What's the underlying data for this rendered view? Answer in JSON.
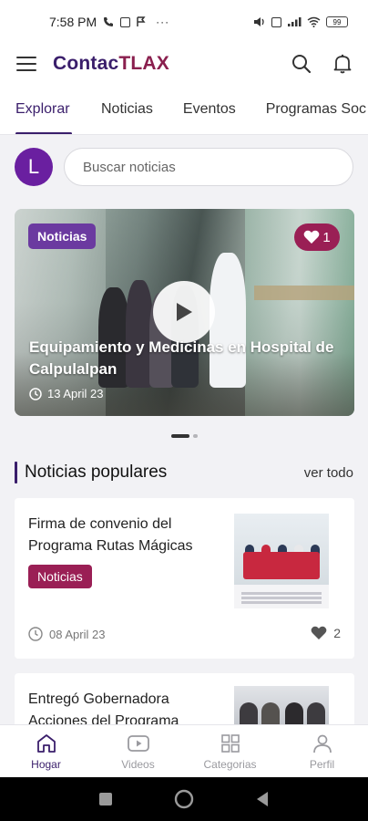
{
  "status_bar": {
    "time": "7:58 PM",
    "battery": "99"
  },
  "header": {
    "logo_part1": "Contac",
    "logo_part2": "TLAX",
    "icons": [
      "menu-icon",
      "search-icon",
      "bell-icon"
    ]
  },
  "tabs": [
    {
      "label": "Explorar",
      "active": true
    },
    {
      "label": "Noticias"
    },
    {
      "label": "Eventos"
    },
    {
      "label": "Programas Soc"
    }
  ],
  "search": {
    "avatar_letter": "L",
    "placeholder": "Buscar noticias"
  },
  "featured": {
    "badge": "Noticias",
    "likes": "1",
    "title": "Equipamiento y Medicinas en Hospital de Calpulalpan",
    "date": "13 April 23"
  },
  "popular": {
    "title": "Noticias populares",
    "see_all": "ver todo",
    "items": [
      {
        "title": "Firma de convenio del Programa Rutas Mágicas",
        "badge": "Noticias",
        "date": "08 April 23",
        "likes": "2"
      },
      {
        "title": "Entregó Gobernadora Acciones del Programa"
      }
    ]
  },
  "bottom_nav": [
    {
      "label": "Hogar",
      "icon": "home-icon",
      "active": true
    },
    {
      "label": "Videos",
      "icon": "video-icon"
    },
    {
      "label": "Categorias",
      "icon": "grid-icon"
    },
    {
      "label": "Perfil",
      "icon": "user-icon"
    }
  ],
  "colors": {
    "brand_purple": "#3a1e6b",
    "brand_maroon": "#9a1f55",
    "badge_purple": "#6b3aa0"
  }
}
